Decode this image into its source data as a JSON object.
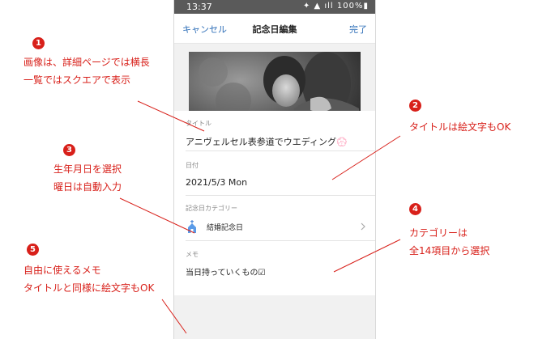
{
  "status": {
    "time": "13:37",
    "icons": "✦ ▲ ıll 100%▮"
  },
  "nav": {
    "cancel": "キャンセル",
    "title": "記念日編集",
    "done": "完了"
  },
  "form": {
    "title_label": "タイトル",
    "title_value": "アニヴェルセル表参道でウエディング💮",
    "date_label": "日付",
    "date_value": "2021/5/3 Mon",
    "category_label": "記念日カテゴリー",
    "category_value": "結婚記念日",
    "memo_label": "メモ",
    "memo_value": "当日持っていくもの☑"
  },
  "annotations": [
    {
      "num": "1",
      "lines": [
        "画像は、詳細ページでは横長",
        "一覧ではスクエアで表示"
      ]
    },
    {
      "num": "2",
      "lines": [
        "タイトルは絵文字もOK"
      ]
    },
    {
      "num": "3",
      "lines": [
        "生年月日を選択",
        "曜日は自動入力"
      ]
    },
    {
      "num": "4",
      "lines": [
        "カテゴリーは",
        "全14項目から選択"
      ]
    },
    {
      "num": "5",
      "lines": [
        "自由に使えるメモ",
        "タイトルと同様に絵文字もOK"
      ]
    }
  ],
  "colors": {
    "accent": "#d8201a",
    "link": "#2f6fb8"
  },
  "icons": {
    "camera": "camera-icon",
    "chevron": "chevron-right-icon",
    "category": "chapel-icon"
  }
}
